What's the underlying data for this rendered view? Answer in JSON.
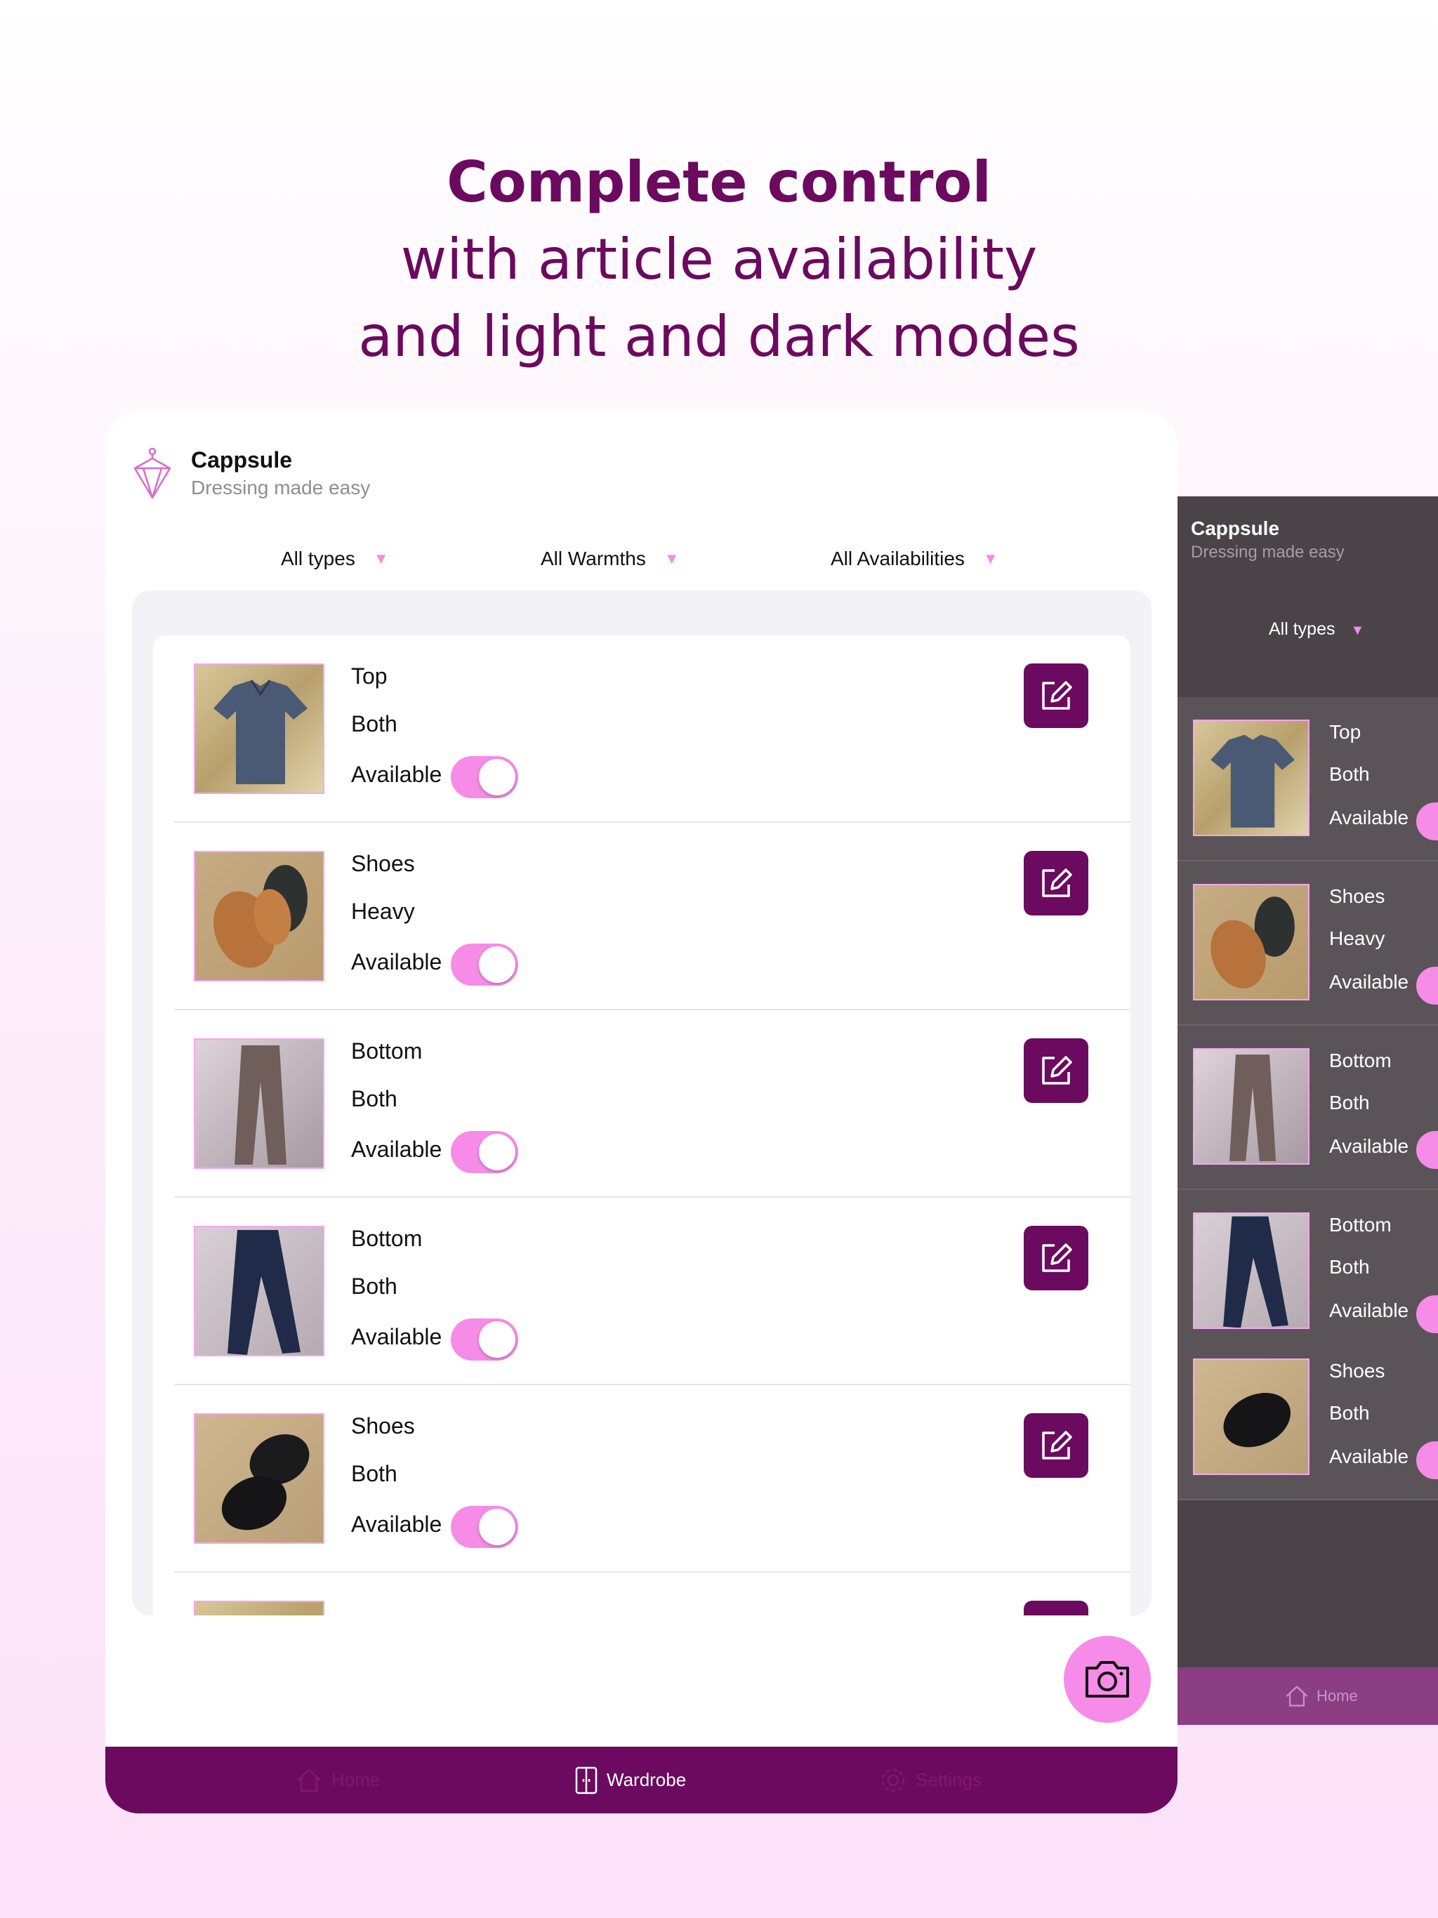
{
  "headline": {
    "line1": "Complete control",
    "line2": "with article availability",
    "line3": "and light and dark modes"
  },
  "app": {
    "title": "Cappsule",
    "subtitle": "Dressing made easy"
  },
  "filters": {
    "type": "All types",
    "warmth": "All Warmths",
    "availability": "All Availabilities"
  },
  "items": [
    {
      "type": "Top",
      "warmth": "Both",
      "availability": "Available",
      "available": true,
      "image": "shirt"
    },
    {
      "type": "Shoes",
      "warmth": "Heavy",
      "availability": "Available",
      "available": true,
      "image": "boots"
    },
    {
      "type": "Bottom",
      "warmth": "Both",
      "availability": "Available",
      "available": true,
      "image": "pants"
    },
    {
      "type": "Bottom",
      "warmth": "Both",
      "availability": "Available",
      "available": true,
      "image": "jeans"
    },
    {
      "type": "Shoes",
      "warmth": "Both",
      "availability": "Available",
      "available": true,
      "image": "shoes"
    }
  ],
  "tabs": {
    "home": "Home",
    "wardrobe": "Wardrobe",
    "settings": "Settings",
    "active": "wardrobe"
  },
  "dark": {
    "title": "Cappsule",
    "subtitle": "Dressing made easy",
    "filter_type": "All types",
    "tab_home": "Home"
  },
  "icons": {
    "logo": "hanger-diamond-icon",
    "edit": "edit-icon",
    "camera": "camera-icon",
    "home": "home-icon",
    "wardrobe": "wardrobe-icon",
    "settings": "gear-icon",
    "dropdown": "triangle-down-icon"
  },
  "colors": {
    "brand": "#6b0a5e",
    "accent": "#f68be8",
    "headline": "#6b0a5e",
    "dark_bg": "#4a4449"
  }
}
